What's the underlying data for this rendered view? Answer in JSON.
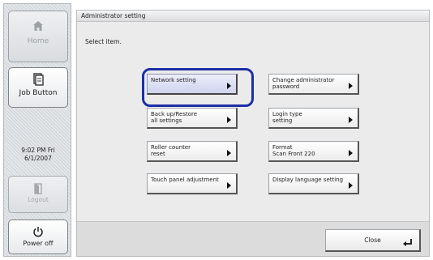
{
  "sidebar": {
    "home_label": "Home",
    "job_label": "Job Button",
    "clock_time": "9:02 PM  Fri",
    "clock_date": "6/1/2007",
    "logout_label": "Logout",
    "power_label": "Power off"
  },
  "main": {
    "title": "Administrator setting",
    "prompt": "Select item.",
    "options": [
      {
        "line1": "Network setting",
        "line2": "",
        "selected": true
      },
      {
        "line1": "Change administrator",
        "line2": "password",
        "selected": false
      },
      {
        "line1": "Back up/Restore",
        "line2": "all settings",
        "selected": false
      },
      {
        "line1": "Login type",
        "line2": "setting",
        "selected": false
      },
      {
        "line1": "Roller counter",
        "line2": "reset",
        "selected": false
      },
      {
        "line1": "Format",
        "line2": "Scan Front 220",
        "selected": false
      },
      {
        "line1": "Touch panel adjustment",
        "line2": "",
        "selected": false
      },
      {
        "line1": "Display language setting",
        "line2": "",
        "selected": false
      }
    ],
    "close_label": "Close"
  },
  "colors": {
    "selection_ring": "#1c2fa6",
    "selected_fill": "#cfd3ee"
  },
  "icons": [
    "home-icon",
    "job-button-icon",
    "logout-icon",
    "power-icon",
    "arrow-right-icon",
    "enter-icon"
  ]
}
